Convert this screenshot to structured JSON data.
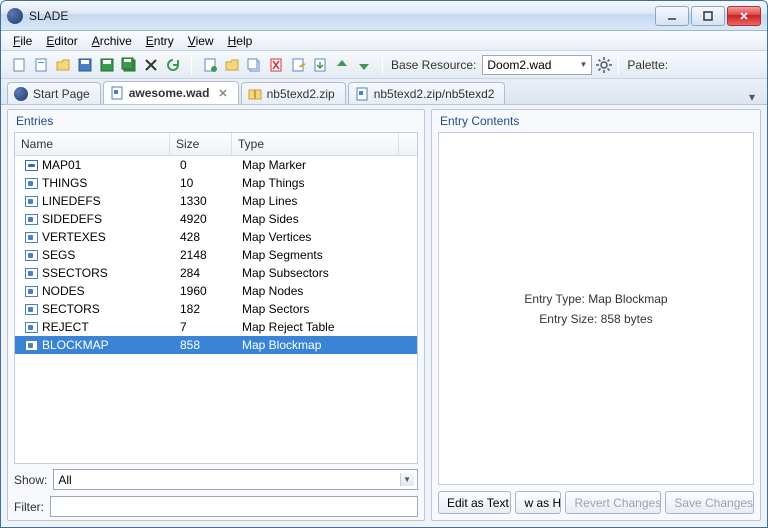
{
  "window": {
    "title": "SLADE"
  },
  "menu": [
    "File",
    "Editor",
    "Archive",
    "Entry",
    "View",
    "Help"
  ],
  "toolbar": {
    "base_resource_label": "Base Resource:",
    "base_resource_value": "Doom2.wad",
    "palette_label": "Palette:"
  },
  "tabs": [
    {
      "label": "Start Page",
      "icon": "app",
      "active": false,
      "closable": false
    },
    {
      "label": "awesome.wad",
      "icon": "wad",
      "active": true,
      "closable": true
    },
    {
      "label": "nb5texd2.zip",
      "icon": "zip",
      "active": false,
      "closable": false
    },
    {
      "label": "nb5texd2.zip/nb5texd2",
      "icon": "wad",
      "active": false,
      "closable": false
    }
  ],
  "entries_title": "Entries",
  "columns": {
    "name": "Name",
    "size": "Size",
    "type": "Type"
  },
  "entries": [
    {
      "name": "MAP01",
      "size": "0",
      "type": "Map Marker",
      "ico": "marker",
      "selected": false
    },
    {
      "name": "THINGS",
      "size": "10",
      "type": "Map Things",
      "ico": "lump",
      "selected": false
    },
    {
      "name": "LINEDEFS",
      "size": "1330",
      "type": "Map Lines",
      "ico": "lump",
      "selected": false
    },
    {
      "name": "SIDEDEFS",
      "size": "4920",
      "type": "Map Sides",
      "ico": "lump",
      "selected": false
    },
    {
      "name": "VERTEXES",
      "size": "428",
      "type": "Map Vertices",
      "ico": "lump",
      "selected": false
    },
    {
      "name": "SEGS",
      "size": "2148",
      "type": "Map Segments",
      "ico": "lump",
      "selected": false
    },
    {
      "name": "SSECTORS",
      "size": "284",
      "type": "Map Subsectors",
      "ico": "lump",
      "selected": false
    },
    {
      "name": "NODES",
      "size": "1960",
      "type": "Map Nodes",
      "ico": "lump",
      "selected": false
    },
    {
      "name": "SECTORS",
      "size": "182",
      "type": "Map Sectors",
      "ico": "lump",
      "selected": false
    },
    {
      "name": "REJECT",
      "size": "7",
      "type": "Map Reject Table",
      "ico": "lump",
      "selected": false
    },
    {
      "name": "BLOCKMAP",
      "size": "858",
      "type": "Map Blockmap",
      "ico": "lump",
      "selected": true
    }
  ],
  "show_label": "Show:",
  "show_value": "All",
  "filter_label": "Filter:",
  "filter_value": "",
  "contents_title": "Entry Contents",
  "contents": {
    "type_line": "Entry Type: Map Blockmap",
    "size_line": "Entry Size: 858 bytes"
  },
  "buttons": {
    "edit_text": "Edit as Text",
    "view_hex": "w as H",
    "revert": "Revert Changes",
    "save": "Save Changes"
  },
  "toolbar_icons": [
    "new-archive-icon",
    "new-entry-icon",
    "open-icon",
    "save-icon",
    "save-green-icon",
    "save-all-icon",
    "close-icon",
    "refresh-icon",
    "sep",
    "entry-new-icon",
    "entry-open-icon",
    "entry-copy-icon",
    "entry-delete-icon",
    "entry-rename-icon",
    "entry-import-icon",
    "entry-up-icon",
    "entry-down-icon"
  ]
}
